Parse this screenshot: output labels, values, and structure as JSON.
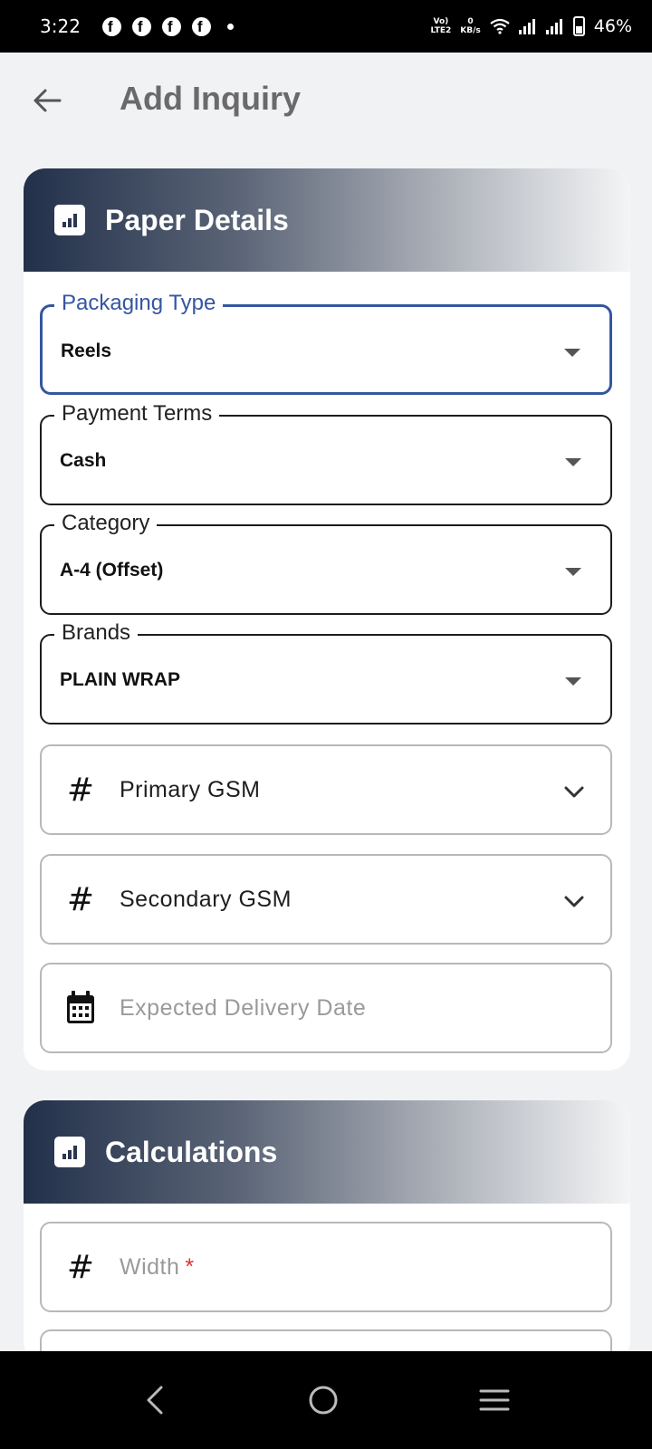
{
  "status_bar": {
    "time": "3:22",
    "network_label_1": "Vo)",
    "network_label_2": "LTE2",
    "speed_value": "0",
    "speed_unit": "KB/s",
    "battery": "46%"
  },
  "app_bar": {
    "title": "Add Inquiry",
    "back_icon": "arrow-left-icon"
  },
  "paper_details": {
    "title": "Paper Details",
    "fields": [
      {
        "label": "Packaging Type",
        "value": "Reels"
      },
      {
        "label": "Payment Terms",
        "value": "Cash"
      },
      {
        "label": "Category",
        "value": "A-4 (Offset)"
      },
      {
        "label": "Brands",
        "value": "PLAIN WRAP"
      }
    ],
    "primary_gsm": "Primary GSM",
    "secondary_gsm": "Secondary GSM",
    "delivery_date_placeholder": "Expected Delivery Date"
  },
  "calculations": {
    "title": "Calculations",
    "width_placeholder": "Width",
    "required_mark": "*"
  },
  "colors": {
    "accent": "#3556a0",
    "header_dark": "#22304a",
    "required": "#dd3333"
  }
}
